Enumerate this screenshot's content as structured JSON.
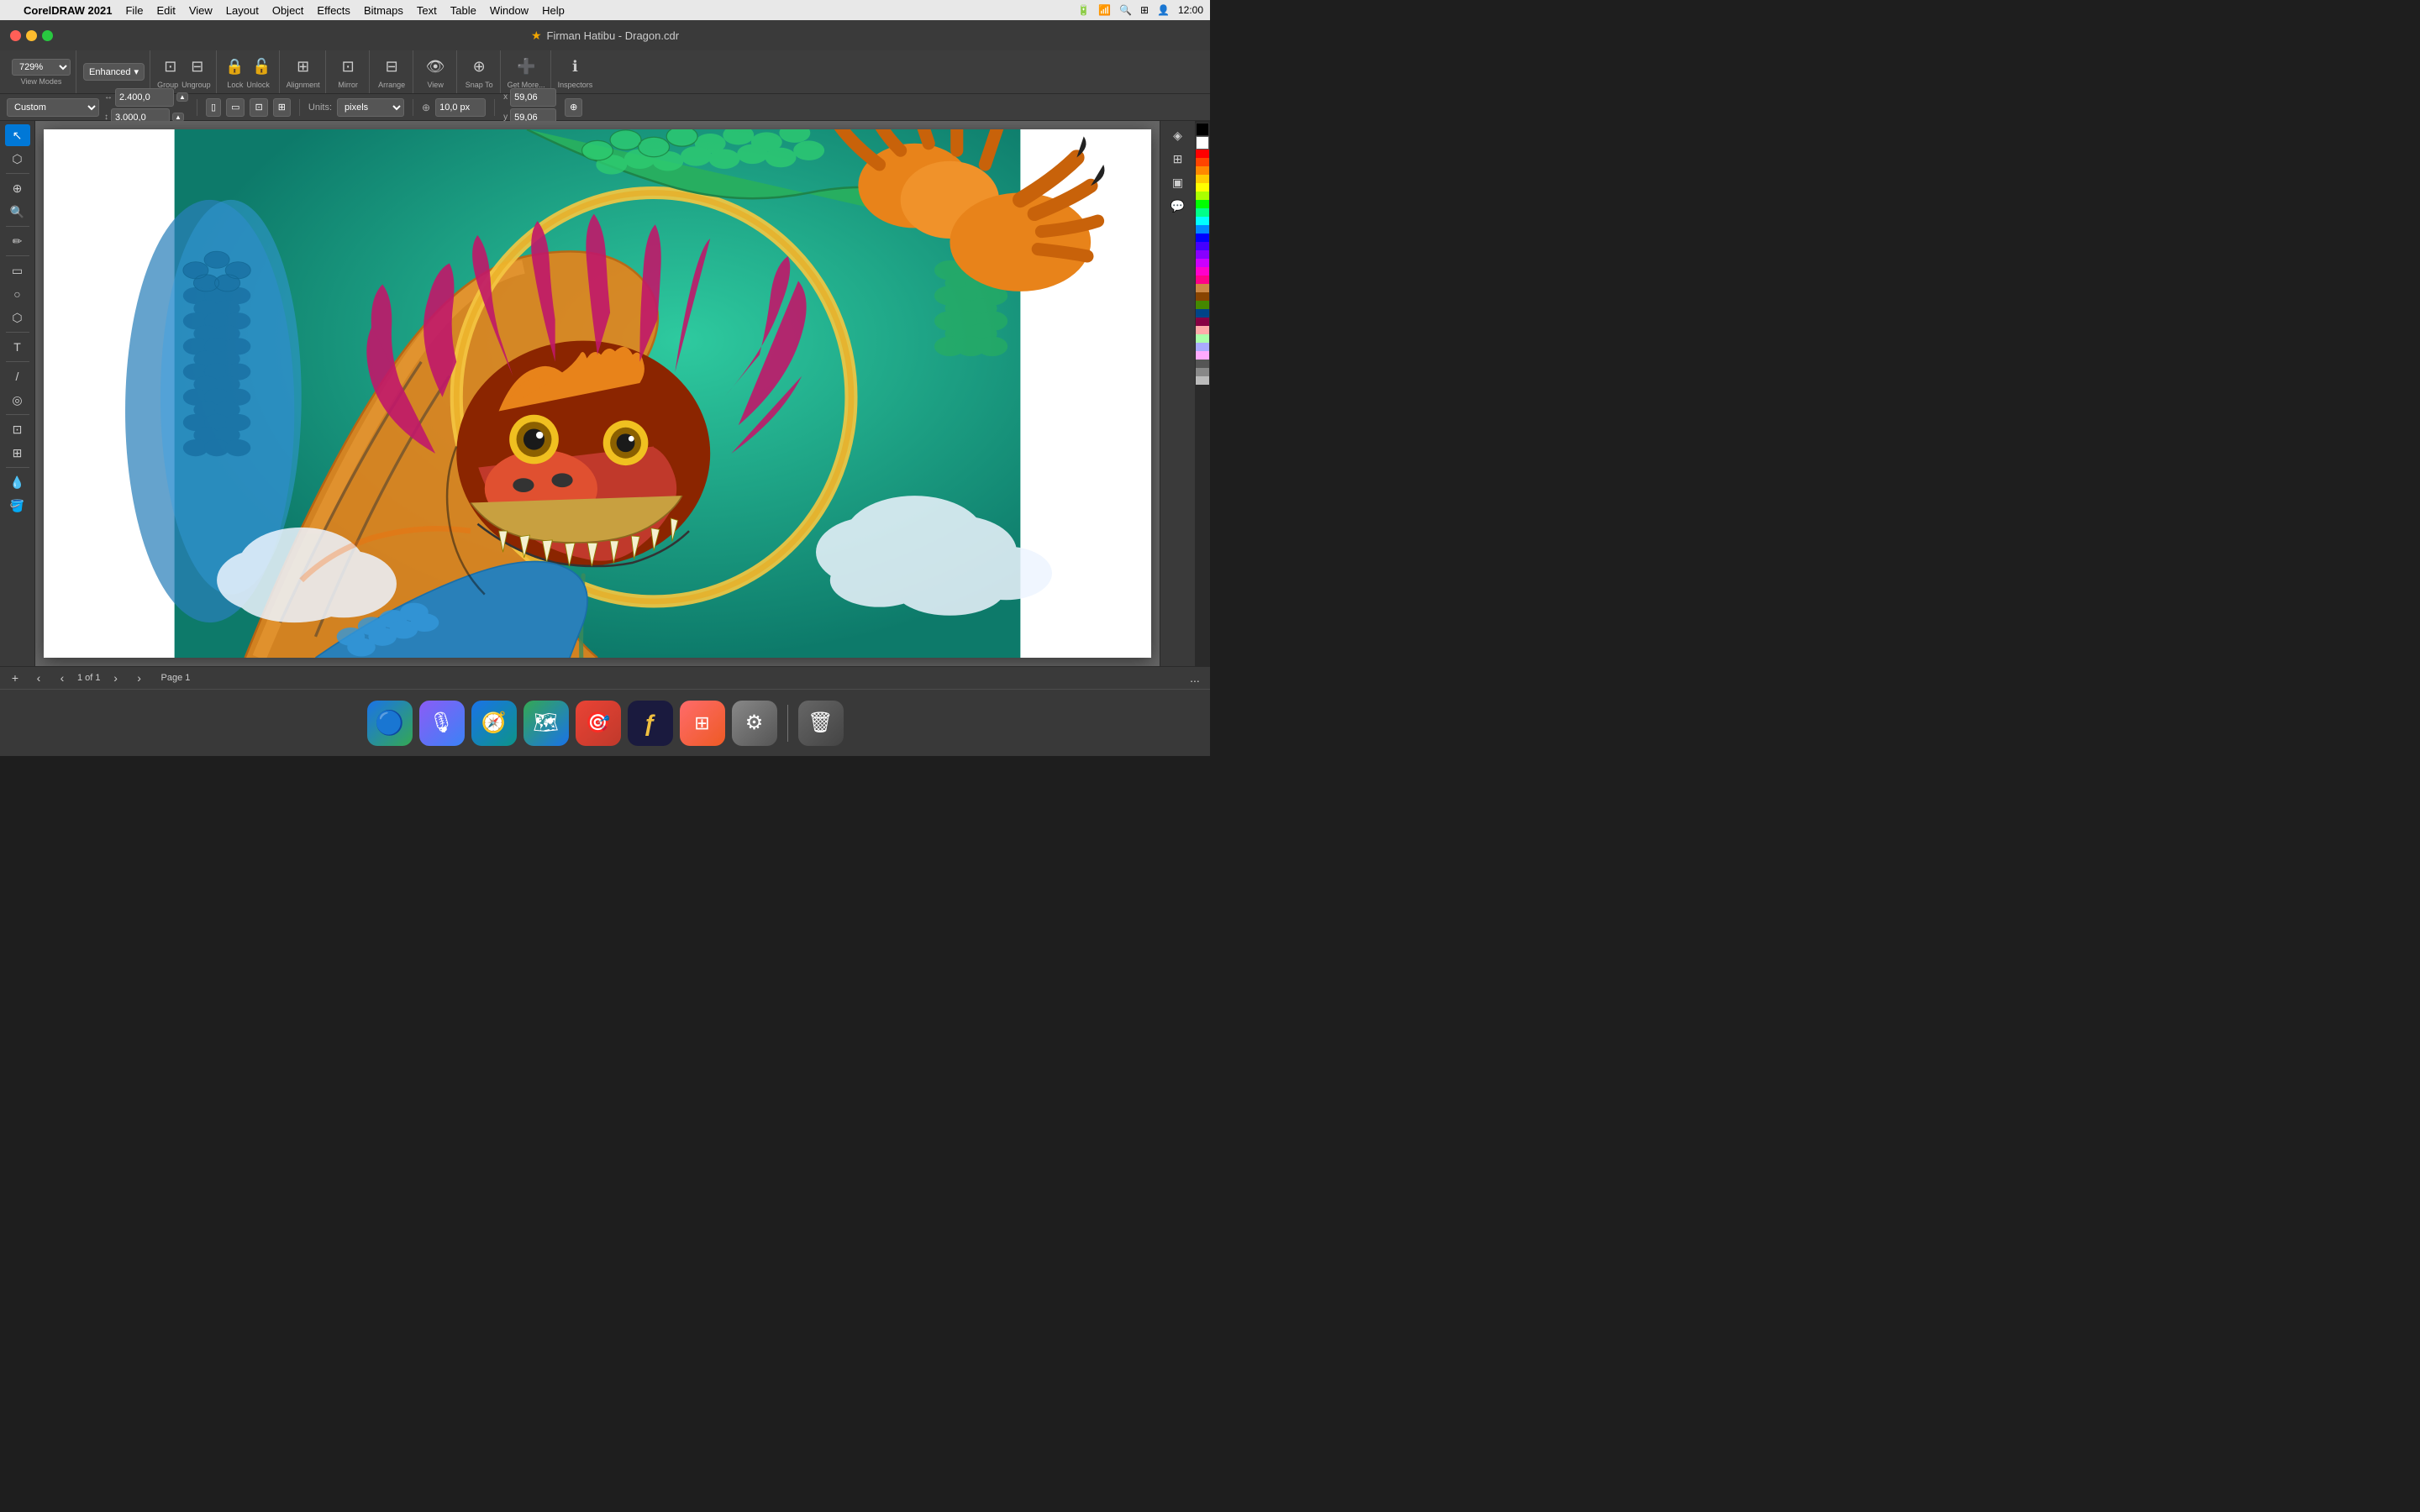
{
  "menubar": {
    "apple": "",
    "app_name": "CorelDRAW 2021",
    "menus": [
      "File",
      "Edit",
      "View",
      "Layout",
      "Object",
      "Effects",
      "Bitmaps",
      "Text",
      "Table",
      "Window",
      "Help"
    ]
  },
  "titlebar": {
    "title": "Firman Hatibu - Dragon.cdr",
    "icon": "★"
  },
  "toolbar": {
    "zoom_value": "729%",
    "view_modes_label": "View Modes",
    "enhanced_label": "Enhanced",
    "group_label": "Group",
    "ungroup_label": "Ungroup",
    "lock_label": "Lock",
    "unlock_label": "Unlock",
    "alignment_label": "Alignment",
    "mirror_label": "Mirror",
    "arrange_label": "Arrange",
    "view_label": "View",
    "snap_to_label": "Snap To",
    "get_more_label": "Get More...",
    "inspectors_label": "Inspectors"
  },
  "propbar": {
    "custom_label": "Custom",
    "width_value": "2.400,0",
    "height_value": "3.000,0",
    "units_label": "Units:",
    "units_value": "pixels",
    "nudge_value": "10,0 px",
    "x_value": "59,06",
    "y_value": "59,06"
  },
  "statusbar": {
    "page_text": "1 of 1",
    "page_name": "Page 1",
    "dots": "..."
  },
  "tools": [
    {
      "name": "select-tool",
      "icon": "↖",
      "active": true
    },
    {
      "name": "freehand-pick-tool",
      "icon": "⬡"
    },
    {
      "name": "transform-tool",
      "icon": "⊕"
    },
    {
      "name": "zoom-tool",
      "icon": "⊕"
    },
    {
      "name": "freehand-tool",
      "icon": "∿"
    },
    {
      "name": "rectangle-tool",
      "icon": "▭"
    },
    {
      "name": "ellipse-tool",
      "icon": "○"
    },
    {
      "name": "polygon-tool",
      "icon": "⬡"
    },
    {
      "name": "text-tool",
      "icon": "T"
    },
    {
      "name": "line-tool",
      "icon": "/"
    },
    {
      "name": "spiral-tool",
      "icon": "◎"
    },
    {
      "name": "crop-tool",
      "icon": "⊡"
    },
    {
      "name": "mesh-tool",
      "icon": "⊞"
    },
    {
      "name": "eyedropper-tool",
      "icon": "⊘"
    },
    {
      "name": "fill-tool",
      "icon": "⊓"
    }
  ],
  "right_tools": [
    {
      "name": "color-styles",
      "icon": "◈"
    },
    {
      "name": "transform",
      "icon": "⊞"
    },
    {
      "name": "copy-attributes",
      "icon": "▣"
    },
    {
      "name": "comment",
      "icon": "💬"
    }
  ],
  "color_palette": {
    "colors": [
      "#000000",
      "#ffffff",
      "#808080",
      "#c0c0c0",
      "#ff0000",
      "#ff8000",
      "#ffff00",
      "#00ff00",
      "#00ffff",
      "#0000ff",
      "#8000ff",
      "#ff00ff",
      "#ff6666",
      "#ff9966",
      "#ffcc66",
      "#66ff66",
      "#66ccff",
      "#6666ff",
      "#cc66ff",
      "#ff66cc",
      "#993300",
      "#cc6600",
      "#999900",
      "#006600",
      "#006666",
      "#000099",
      "#660099",
      "#990066",
      "#ffcccc",
      "#ffe5cc",
      "#ffffcc",
      "#ccffcc",
      "#ccffff",
      "#ccccff",
      "#e5ccff",
      "#ffccee",
      "#660000",
      "#993300",
      "#666600",
      "#003300",
      "#003366",
      "#000066",
      "#330066",
      "#660033",
      "#ff3366",
      "#3366ff",
      "#33cc33",
      "#ff9900"
    ]
  },
  "dock": {
    "apps": [
      {
        "name": "finder",
        "icon": "🔵",
        "bg": "#1a73e8",
        "label": "Finder"
      },
      {
        "name": "siri",
        "icon": "🎙",
        "bg": "#8b5cf6",
        "label": "Siri"
      },
      {
        "name": "safari",
        "icon": "🧭",
        "bg": "#1a73e8",
        "label": "Safari"
      },
      {
        "name": "maps",
        "icon": "🗺",
        "bg": "#34a853",
        "label": "Maps"
      },
      {
        "name": "rnote",
        "icon": "🎯",
        "bg": "#ea4335",
        "label": "App"
      },
      {
        "name": "fontlab",
        "icon": "ƒ",
        "bg": "#1a1a2e",
        "label": "Fontlab"
      },
      {
        "name": "launchpad",
        "icon": "⊞",
        "bg": "#444",
        "label": "Launchpad"
      },
      {
        "name": "system-prefs",
        "icon": "⚙",
        "bg": "#888",
        "label": "System Preferences"
      },
      {
        "name": "trash",
        "icon": "🗑",
        "bg": "#555",
        "label": "Trash"
      }
    ]
  }
}
